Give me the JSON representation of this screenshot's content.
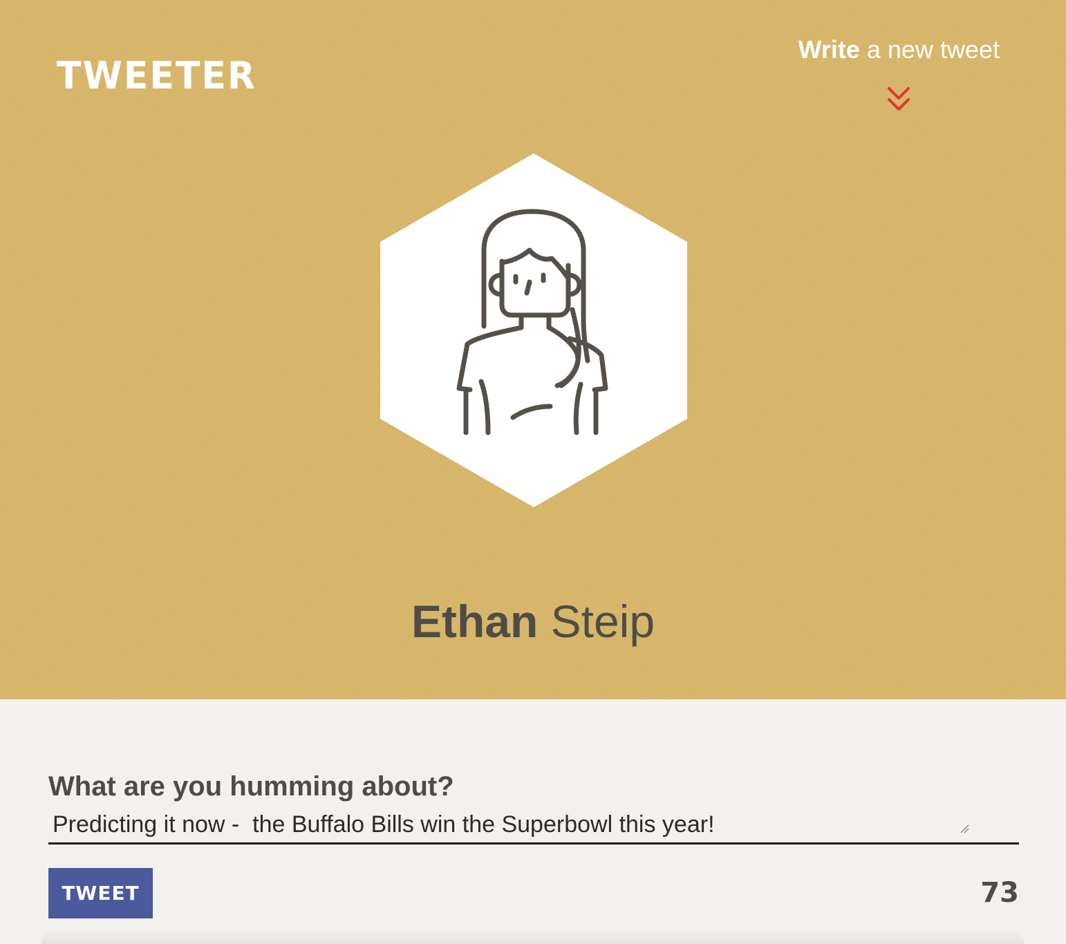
{
  "brand": {
    "logo_text": "TWEETER"
  },
  "nav": {
    "write_bold": "Write",
    "write_rest": " a new tweet",
    "chevron_icon": "double-chevron-down-icon"
  },
  "profile": {
    "first_name": "Ethan",
    "last_name": " Steip",
    "avatar_icon": "person-long-hair-avatar-icon"
  },
  "compose": {
    "label": "What are you humming about?",
    "value": "Predicting it now -  the Buffalo Bills win the Superbowl this year!",
    "button_label": "TWEET",
    "char_count": "73"
  },
  "colors": {
    "header_bg": "#d7b669",
    "page_bg": "#f3f1ed",
    "button_bg": "#4a5a9c",
    "chevron": "#e4342b",
    "text_dark": "#4f4b46"
  }
}
